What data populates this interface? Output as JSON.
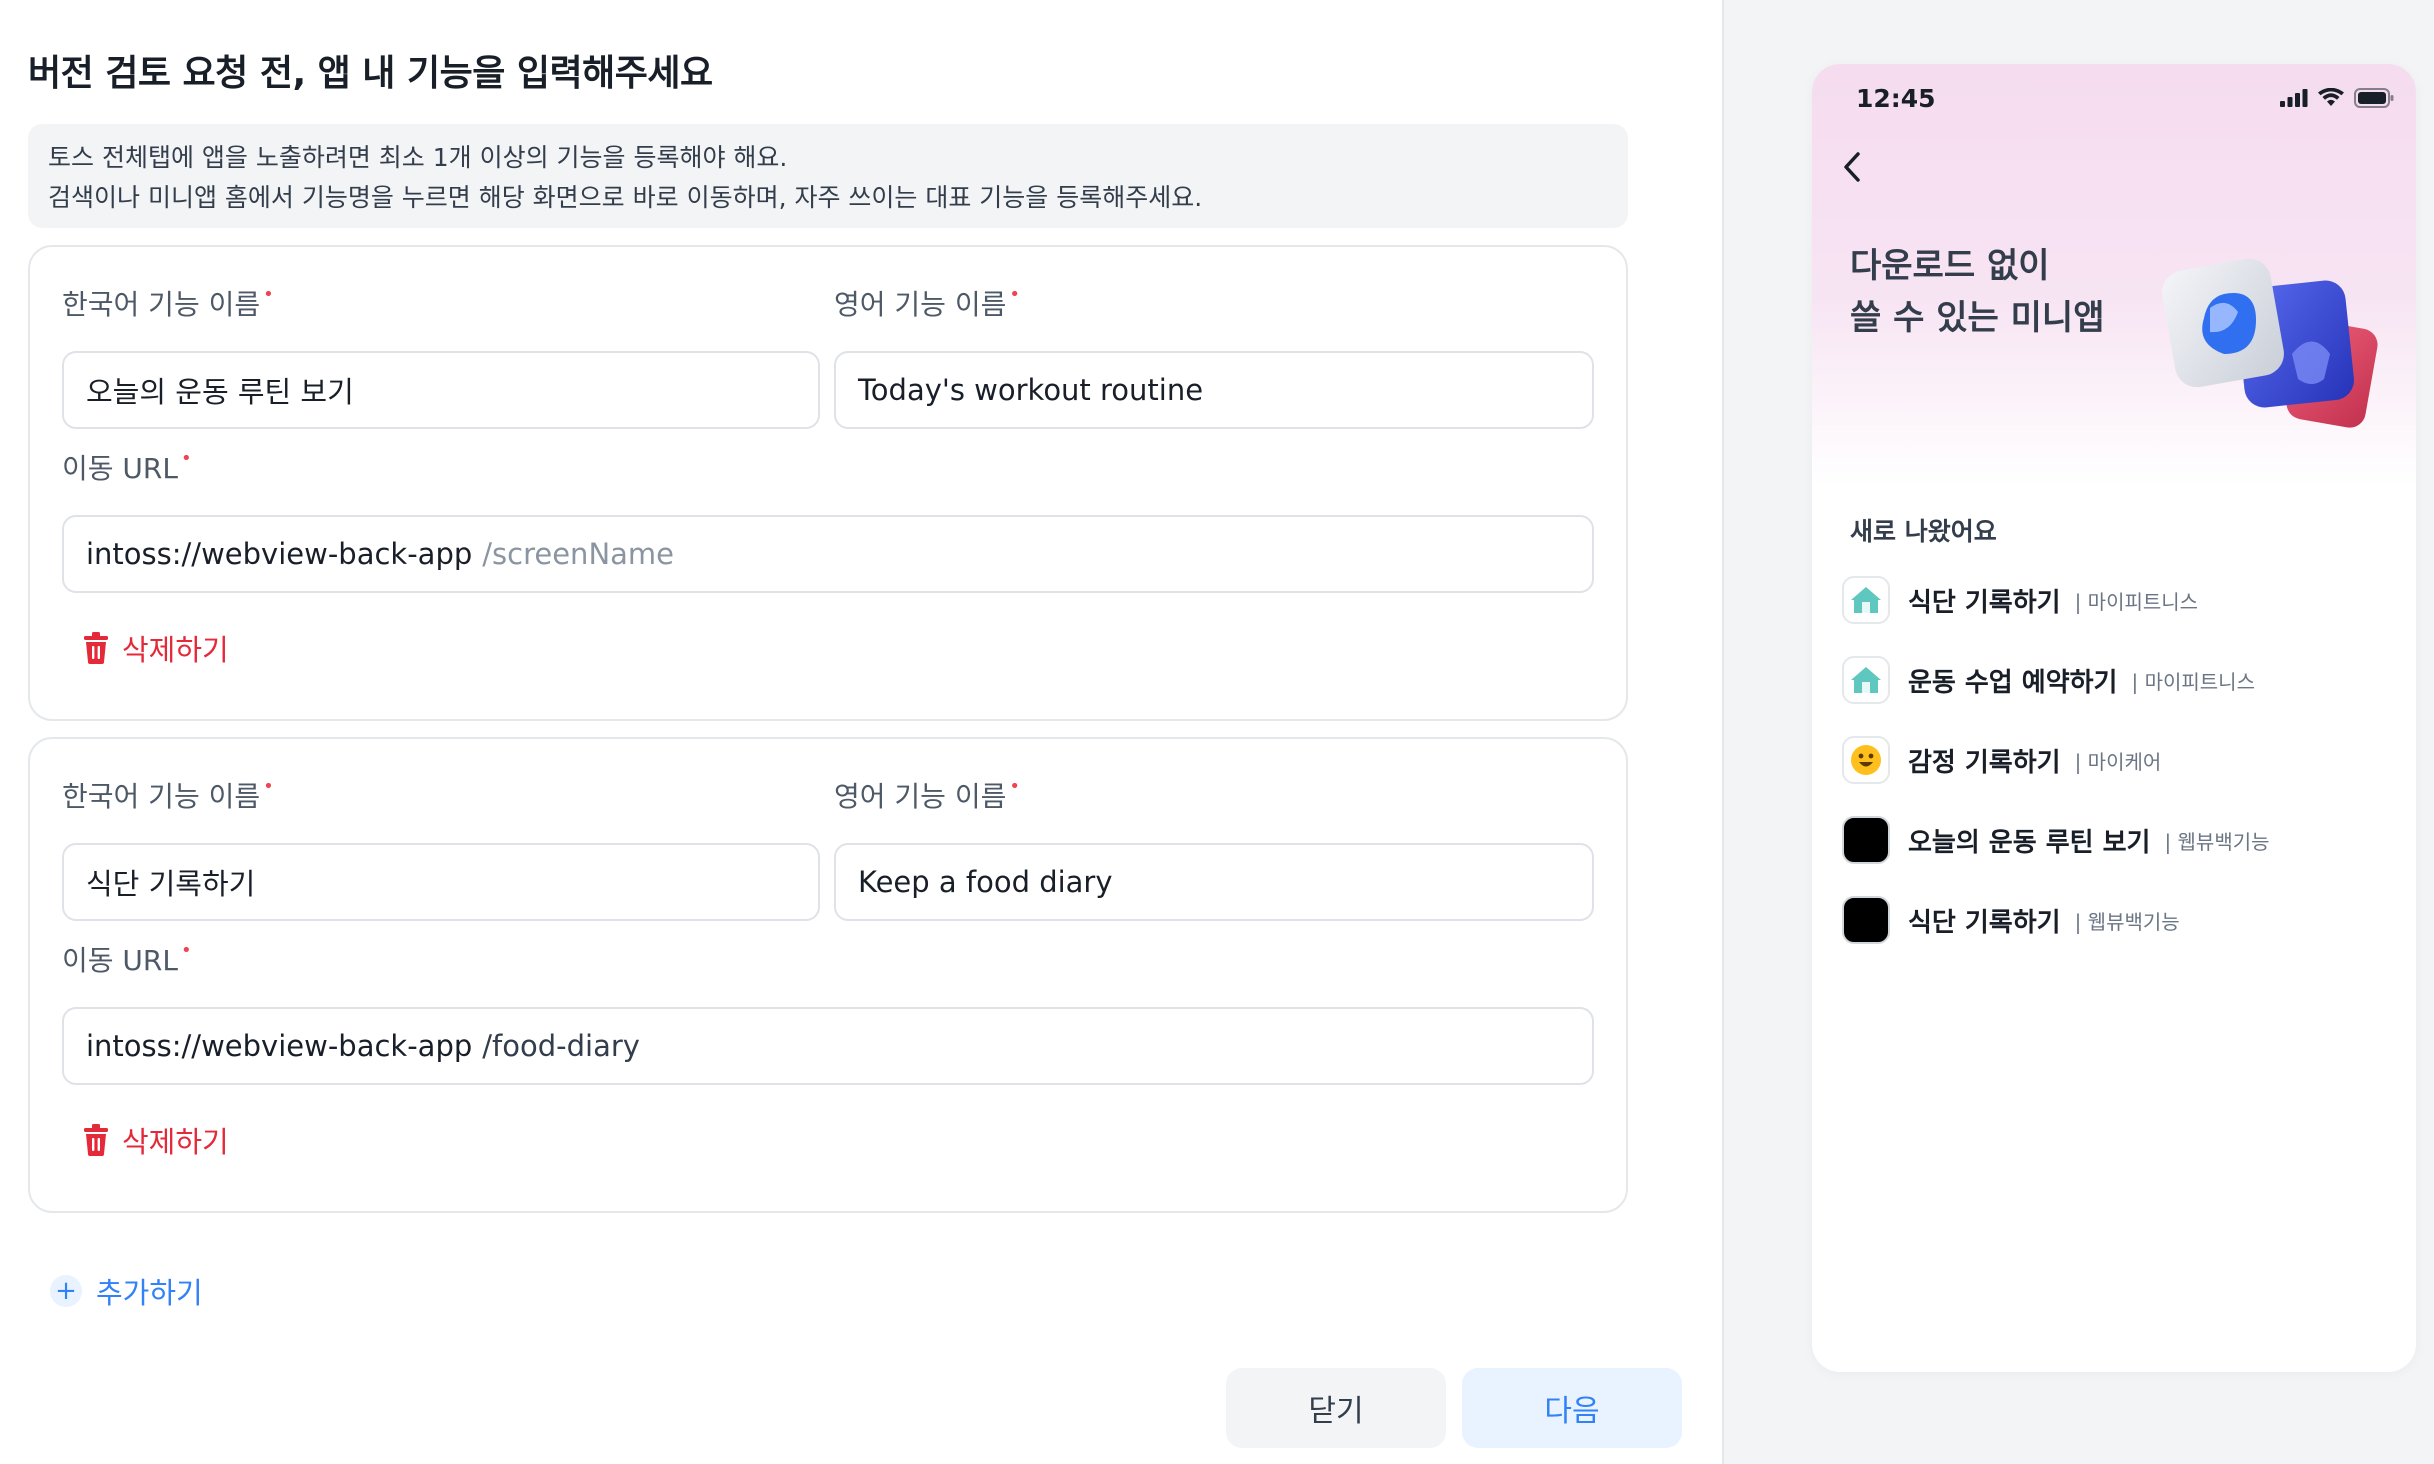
{
  "title": "버전 검토 요청 전, 앱 내 기능을 입력해주세요",
  "info": {
    "line1": "토스 전체탭에 앱을 노출하려면 최소 1개 이상의 기능을 등록해야 해요.",
    "line2": "검색이나 미니앱 홈에서 기능명을 누르면 해당 화면으로 바로 이동하며, 자주 쓰이는 대표 기능을 등록해주세요."
  },
  "labels": {
    "korean_name": "한국어 기능 이름",
    "english_name": "영어 기능 이름",
    "url": "이동 URL",
    "required_mark": "•",
    "delete": "삭제하기",
    "add": "추가하기",
    "url_base": "intoss://webview-back-app"
  },
  "features": [
    {
      "korean": "오늘의 운동 루틴 보기",
      "english": "Today's workout routine",
      "url_placeholder": "/screenName"
    },
    {
      "korean": "식단 기록하기",
      "english": "Keep a food diary",
      "url_path": "/food-diary"
    }
  ],
  "buttons": {
    "close": "닫기",
    "next": "다음"
  },
  "preview": {
    "time": "12:45",
    "hero_line1": "다운로드 없이",
    "hero_line2": "쓸 수 있는 미니앱",
    "section": "새로 나왔어요",
    "items": [
      {
        "name": "식단 기록하기",
        "source": "| 마이피트니스",
        "icon": "house-icon"
      },
      {
        "name": "운동 수업 예약하기",
        "source": "| 마이피트니스",
        "icon": "house-icon"
      },
      {
        "name": "감정 기록하기",
        "source": "| 마이케어",
        "icon": "smiley-icon"
      },
      {
        "name": "오늘의 운동 루틴 보기",
        "source": "| 웹뷰백기능",
        "icon": "blank-app-icon"
      },
      {
        "name": "식단 기록하기",
        "source": "| 웹뷰백기능",
        "icon": "blank-app-icon"
      }
    ]
  },
  "colors": {
    "accent": "#3182f6",
    "danger": "#e42939",
    "required": "#f04452"
  }
}
